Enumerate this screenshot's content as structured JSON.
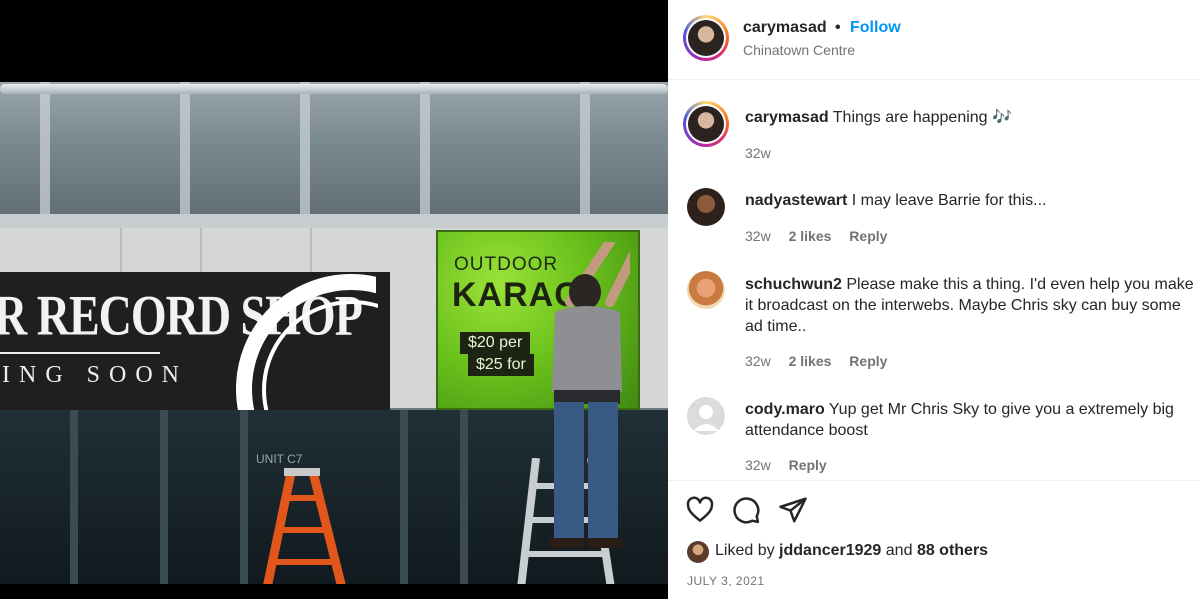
{
  "photo": {
    "awning_text": "R RECORD SHOP",
    "awning_sub": "ING SOON",
    "banner_line1": "OUTDOOR",
    "banner_line2": "KARAC",
    "banner_price1": "$20 per",
    "banner_price2": "$25 for",
    "unit_label": "UNIT C7"
  },
  "header": {
    "username": "carymasad",
    "separator": "•",
    "follow_label": "Follow",
    "location": "Chinatown Centre"
  },
  "caption": {
    "username": "carymasad",
    "text": "Things are happening 🎶",
    "time": "32w"
  },
  "comments": [
    {
      "username": "nadyastewart",
      "text": "I may leave Barrie for this...",
      "time": "32w",
      "likes": "2 likes",
      "reply": "Reply"
    },
    {
      "username": "schuchwun2",
      "text": "Please make this a thing. I'd even help you make it broadcast on the interwebs. Maybe Chris sky can buy some ad time..",
      "time": "32w",
      "likes": "2 likes",
      "reply": "Reply"
    },
    {
      "username": "cody.maro",
      "text": "Yup get Mr Chris Sky to give you a extremely big attendance boost",
      "time": "32w",
      "reply": "Reply"
    }
  ],
  "actions": {
    "icons": [
      "heart-icon",
      "comment-icon",
      "share-icon"
    ],
    "liked_prefix": "Liked by",
    "liked_user": "jddancer1929",
    "liked_and": "and",
    "liked_others": "88 others",
    "date": "JULY 3, 2021"
  }
}
